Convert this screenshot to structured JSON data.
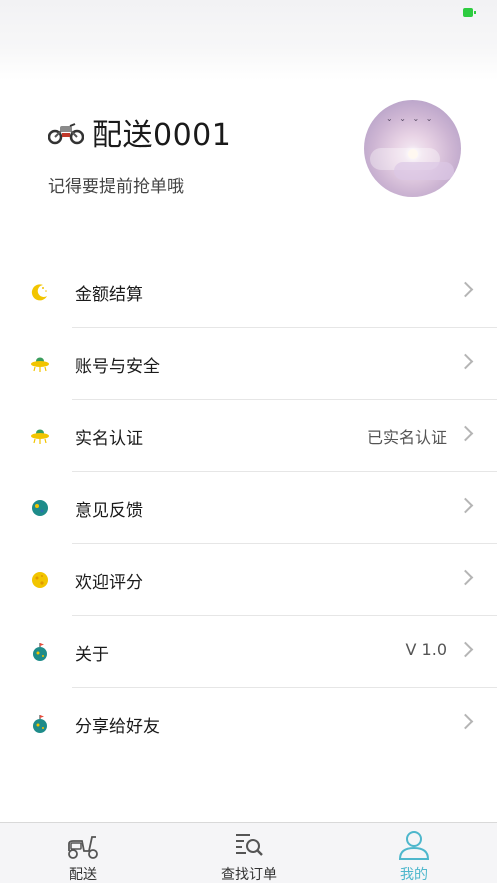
{
  "profile": {
    "name": "配送0001",
    "slogan": "记得要提前抢单哦"
  },
  "menu": [
    {
      "label": "金额结算",
      "value": "",
      "icon": "moon-icon"
    },
    {
      "label": "账号与安全",
      "value": "",
      "icon": "ufo-icon"
    },
    {
      "label": "实名认证",
      "value": "已实名认证",
      "icon": "ufo-icon"
    },
    {
      "label": "意见反馈",
      "value": "",
      "icon": "planet-icon"
    },
    {
      "label": "欢迎评分",
      "value": "",
      "icon": "cheese-icon"
    },
    {
      "label": "关于",
      "value": "V 1.0",
      "icon": "flag-planet-icon"
    },
    {
      "label": "分享给好友",
      "value": "",
      "icon": "flag-planet-icon"
    }
  ],
  "tabs": [
    {
      "label": "配送",
      "icon": "scooter-icon",
      "active": false
    },
    {
      "label": "查找订单",
      "icon": "search-list-icon",
      "active": false
    },
    {
      "label": "我的",
      "icon": "person-icon",
      "active": true
    }
  ],
  "colors": {
    "accent": "#4eb7cc",
    "text": "#1a1a1a",
    "secondary_text": "#555555"
  }
}
